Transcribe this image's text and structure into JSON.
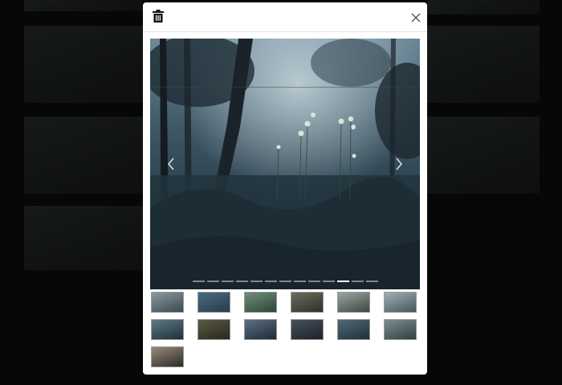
{
  "background": {
    "tile_color": "#1a1d1c",
    "overlay_color": "#000000"
  },
  "modal": {
    "delete_icon": "trash-icon",
    "close_icon": "close-icon",
    "prev_icon": "chevron-left-icon",
    "next_icon": "chevron-right-icon",
    "slide_count": 13,
    "active_slide_index": 10,
    "thumbnails": [
      {
        "tone": [
          "#8a9aa0",
          "#3c4a50"
        ]
      },
      {
        "tone": [
          "#4a6a80",
          "#2a3c48"
        ]
      },
      {
        "tone": [
          "#6f8f7a",
          "#2e4438"
        ]
      },
      {
        "tone": [
          "#6c6c5e",
          "#2e302a"
        ]
      },
      {
        "tone": [
          "#9aa7a0",
          "#3c4840"
        ]
      },
      {
        "tone": [
          "#9fb0b6",
          "#46565c"
        ]
      },
      {
        "tone": [
          "#5d7a86",
          "#1f2f36"
        ]
      },
      {
        "tone": [
          "#5a5a46",
          "#28281c"
        ]
      },
      {
        "tone": [
          "#5c7082",
          "#1f2a36"
        ]
      },
      {
        "tone": [
          "#47505a",
          "#1e2229"
        ]
      },
      {
        "tone": [
          "#4f6a76",
          "#213036"
        ]
      },
      {
        "tone": [
          "#7b8c92",
          "#33403f"
        ]
      },
      {
        "tone": [
          "#9c8a74",
          "#2a2c2e"
        ]
      }
    ]
  }
}
